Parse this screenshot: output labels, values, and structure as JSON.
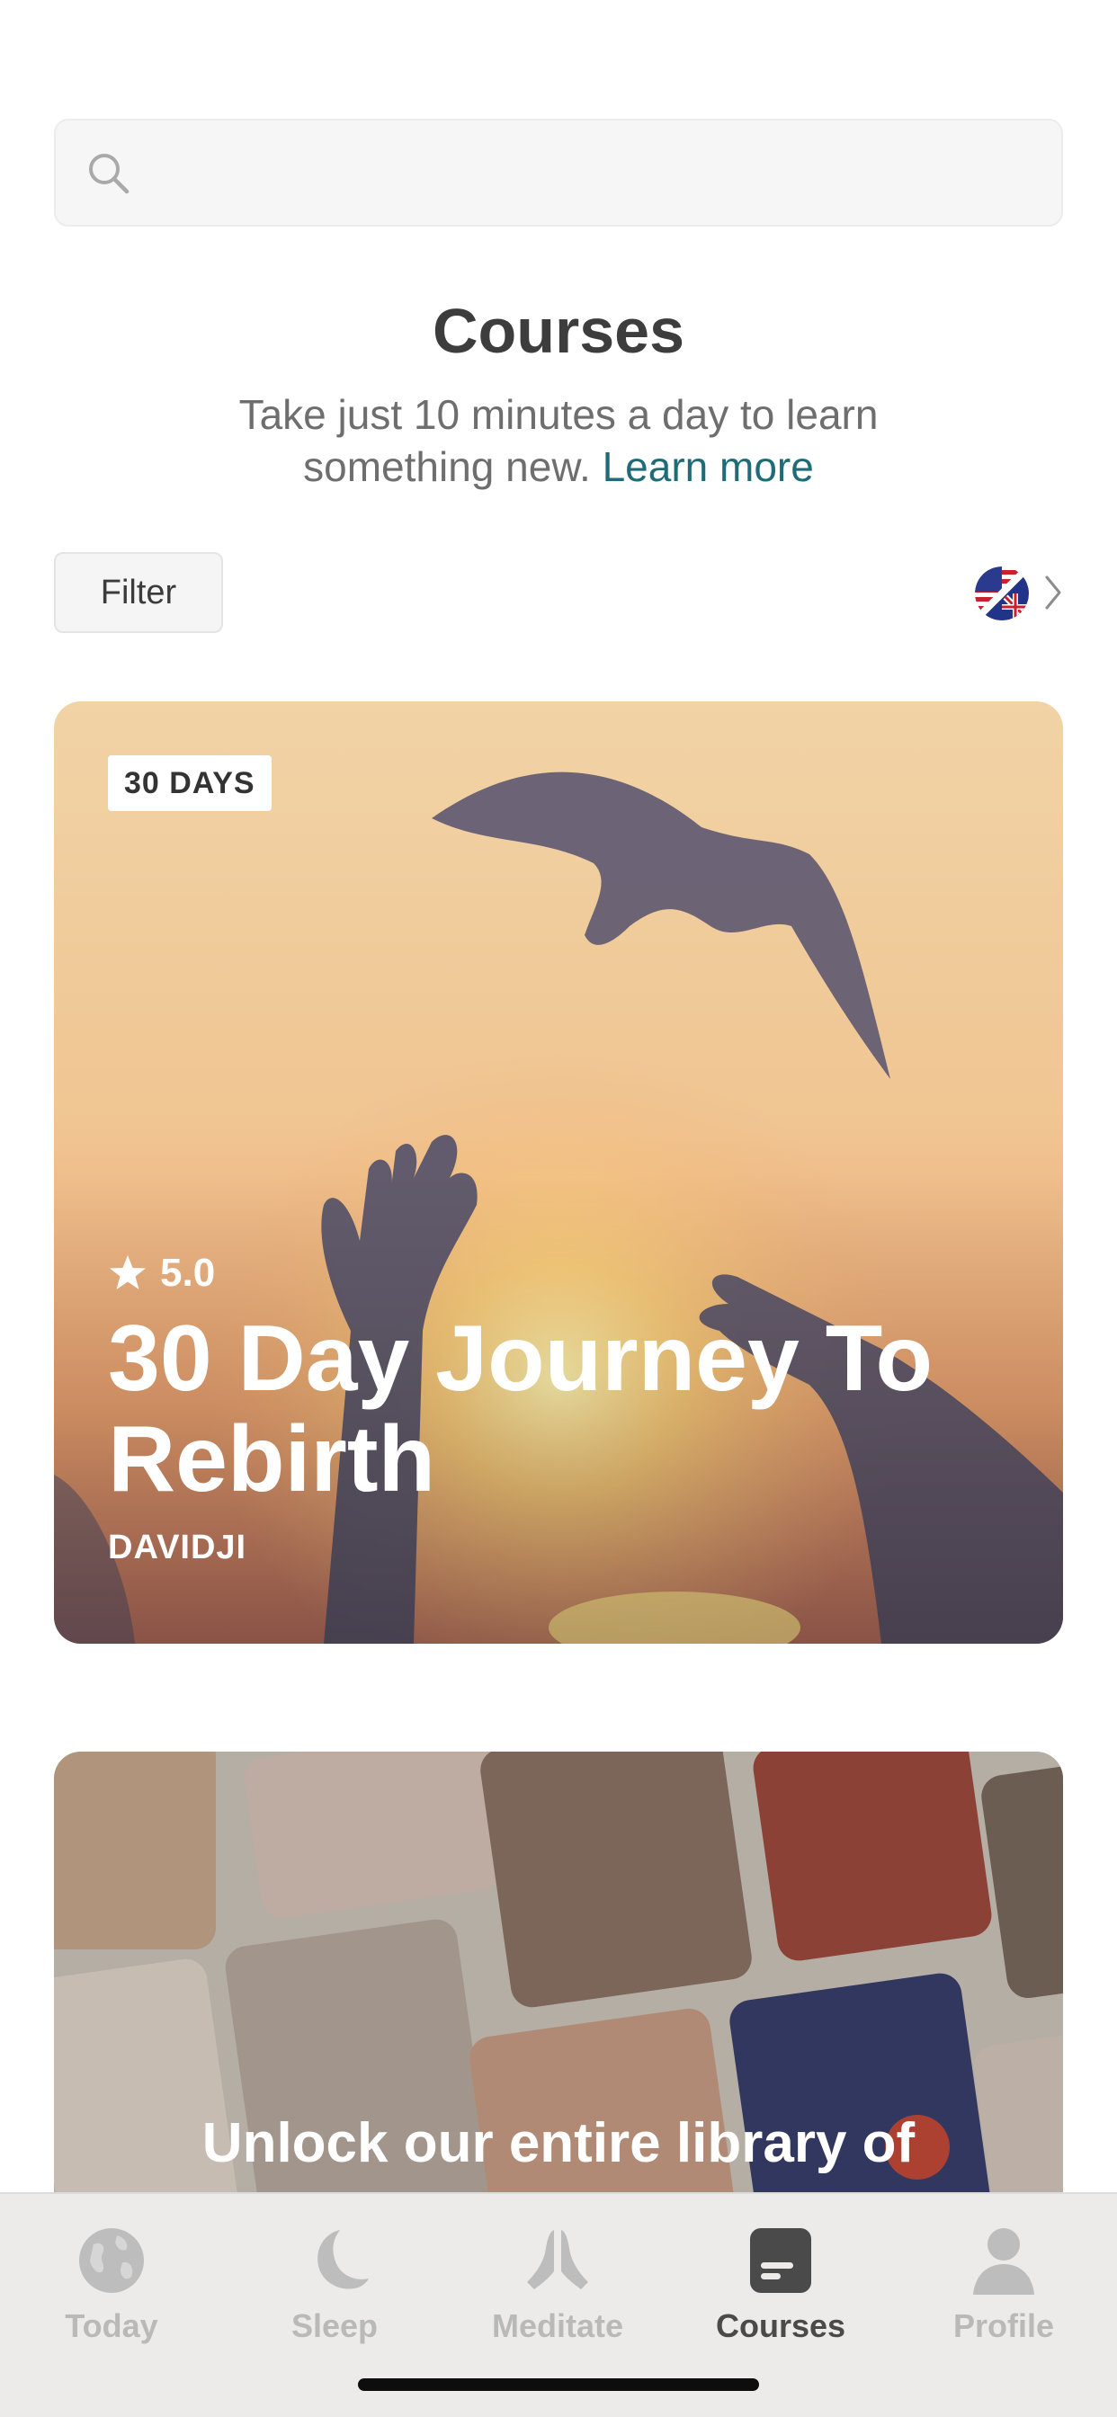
{
  "search": {
    "placeholder": ""
  },
  "header": {
    "title": "Courses",
    "subtitle": "Take just 10 minutes a day to learn something new.",
    "learn_more": "Learn more"
  },
  "filter": {
    "label": "Filter"
  },
  "language": {
    "flag": "uk-us-flag-icon"
  },
  "featured_course": {
    "badge": "30 DAYS",
    "rating": "5.0",
    "title": "30 Day Journey To Rebirth",
    "author": "DAVIDJI"
  },
  "promo": {
    "headline": "Unlock our entire library of"
  },
  "tabs": [
    {
      "label": "Today",
      "icon": "globe-icon"
    },
    {
      "label": "Sleep",
      "icon": "moon-icon"
    },
    {
      "label": "Meditate",
      "icon": "praying-hands-icon"
    },
    {
      "label": "Courses",
      "icon": "courses-icon",
      "active": true
    },
    {
      "label": "Profile",
      "icon": "person-icon"
    }
  ],
  "colors": {
    "accent": "#1f6b78",
    "text": "#3d3d3d",
    "inactive_tab": "#b9b9b9"
  }
}
